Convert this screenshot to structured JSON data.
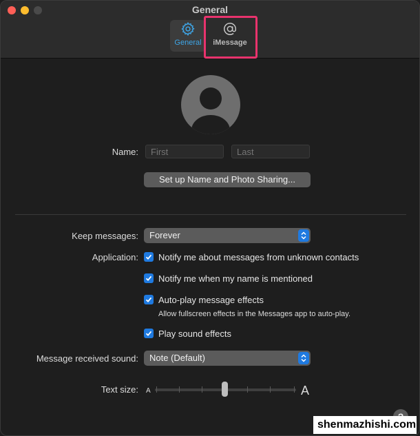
{
  "window": {
    "title": "General"
  },
  "toolbar": {
    "tabs": [
      {
        "label": "General",
        "icon": "gear-icon",
        "selected": true
      },
      {
        "label": "iMessage",
        "icon": "at-sign-icon",
        "selected": false
      }
    ]
  },
  "name": {
    "label": "Name:",
    "first_placeholder": "First",
    "last_placeholder": "Last"
  },
  "setup_button": "Set up Name and Photo Sharing...",
  "keep_messages": {
    "label": "Keep messages:",
    "value": "Forever"
  },
  "application": {
    "label": "Application:",
    "options": [
      {
        "label": "Notify me about messages from unknown contacts",
        "checked": true
      },
      {
        "label": "Notify me when my name is mentioned",
        "checked": true
      },
      {
        "label": "Auto-play message effects",
        "checked": true
      },
      {
        "label": "Play sound effects",
        "checked": true
      }
    ],
    "autoplay_note": "Allow fullscreen effects in the Messages app to auto-play."
  },
  "sound": {
    "label": "Message received sound:",
    "value": "Note (Default)"
  },
  "text_size": {
    "label": "Text size:",
    "small": "A",
    "large": "A",
    "level": 0.5
  },
  "help": "?",
  "watermark": "shenmazhishi.com",
  "colors": {
    "accent": "#1f7ae0",
    "highlight": "#e8336d",
    "tab_active": "#3ea6e8"
  }
}
